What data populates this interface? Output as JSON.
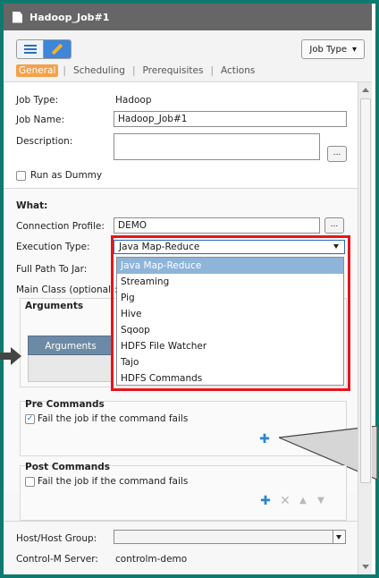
{
  "window": {
    "title": "Hadoop_Job#1"
  },
  "toolbar": {
    "job_type_button": "Job Type",
    "job_type_caret": "▾"
  },
  "tabs": [
    {
      "label": "General",
      "active": true
    },
    {
      "label": "Scheduling",
      "active": false
    },
    {
      "label": "Prerequisites",
      "active": false
    },
    {
      "label": "Actions",
      "active": false
    }
  ],
  "general": {
    "job_type_label": "Job Type:",
    "job_type_value": "Hadoop",
    "job_name_label": "Job Name:",
    "job_name_value": "Hadoop_Job#1",
    "description_label": "Description:",
    "description_value": "",
    "ellipsis": "...",
    "dummy_label": "Run as Dummy",
    "dummy_checked": false
  },
  "what": {
    "heading": "What:",
    "connection_profile_label": "Connection Profile:",
    "connection_profile_value": "DEMO",
    "execution_type_label": "Execution Type:",
    "execution_type_value": "Java Map-Reduce",
    "execution_type_options": [
      "Java Map-Reduce",
      "Streaming",
      "Pig",
      "Hive",
      "Sqoop",
      "HDFS File Watcher",
      "Tajo",
      "HDFS Commands"
    ],
    "full_path_label": "Full Path To Jar:",
    "main_class_label": "Main Class (optional):",
    "arguments_heading": "Arguments",
    "arguments_column": "Arguments"
  },
  "pre_commands": {
    "heading": "Pre Commands",
    "fail_label": "Fail the job if the command fails",
    "fail_checked": true
  },
  "post_commands": {
    "heading": "Post Commands",
    "fail_label": "Fail the job if the command fails",
    "fail_checked": false
  },
  "host": {
    "host_group_label": "Host/Host Group:",
    "host_group_value": "",
    "server_label": "Control-M Server:",
    "server_value": "controlm-demo"
  },
  "icons": {
    "plus": "✚",
    "delete": "✕",
    "up": "▲",
    "down": "▼",
    "check": "✓"
  },
  "colors": {
    "frame": "#0e7a6f",
    "titlebar": "#666666",
    "active_tab": "#f3a24a",
    "highlight_box": "#e8141b",
    "selected_option": "#8fb4d9",
    "accent_blue": "#2b86d0"
  }
}
